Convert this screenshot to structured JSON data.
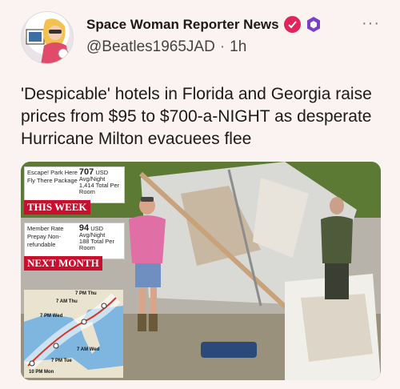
{
  "post": {
    "author_name": "Space Woman Reporter News",
    "handle": "@Beatles1965JAD",
    "separator": "·",
    "time": "1h",
    "more": "···",
    "text": "'Despicable' hotels in Florida and Georgia raise prices from $95 to $700-a-NIGHT as desperate Hurricane Milton evacuees flee"
  },
  "media": {
    "panel_top": {
      "left": "Escape! Park Here Fly There Package",
      "big": "707",
      "big_unit": "USD",
      "sub1": "Avg/Night",
      "sub2": "1,414 Total Per Room"
    },
    "tag_top": "THIS WEEK",
    "panel_bottom": {
      "left": "Member Rate Prepay Non-refundable",
      "big": "94",
      "big_unit": "USD",
      "sub1": "Avg/Night",
      "sub2": "188 Total Per Room"
    },
    "tag_bottom": "NEXT MONTH",
    "map_labels": [
      "7 PM Thu",
      "7 AM Thu",
      "7 PM Wed",
      "7 AM Wed",
      "7 PM Tue",
      "10 PM Mon"
    ]
  },
  "colors": {
    "verified": "#e0245e",
    "badge": "#7b3fc4",
    "tag": "#c8102e"
  }
}
